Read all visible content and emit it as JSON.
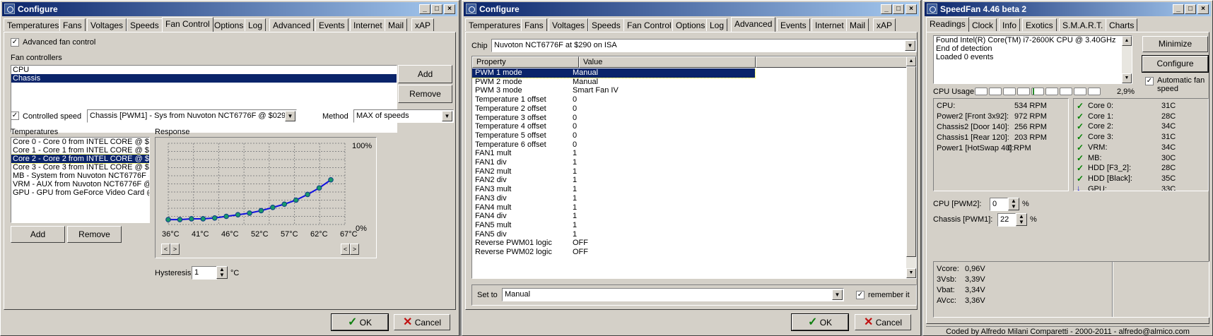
{
  "configure1": {
    "title": "Configure",
    "tabs": [
      "Temperatures",
      "Fans",
      "Voltages",
      "Speeds",
      "Fan Control",
      "Options",
      "Log",
      "Advanced",
      "Events",
      "Internet",
      "Mail",
      "xAP"
    ],
    "advanced_fan_control_label": "Advanced fan control",
    "fan_controllers_label": "Fan controllers",
    "fan_controllers": [
      "CPU",
      "Chassis"
    ],
    "add_label": "Add",
    "remove_label": "Remove",
    "controlled_speed_label": "Controlled speed",
    "controlled_speed_value": "Chassis [PWM1] - Sys from Nuvoton NCT6776F @ $0290",
    "method_label": "Method",
    "method_value": "MAX of speeds",
    "temperatures_label": "Temperatures",
    "temperatures": [
      "Core 0 - Core 0 from INTEL CORE @ $0",
      "Core 1 - Core 1 from INTEL CORE @ $0",
      "Core 2 - Core 2 from INTEL CORE @ $0",
      "Core 3 - Core 3 from INTEL CORE @ $0",
      "MB - System from Nuvoton NCT6776F @",
      "VRM - AUX from Nuvoton NCT6776F @",
      "GPU - GPU from GeForce Video Card @"
    ],
    "response_label": "Response",
    "response_top_label": "100%",
    "response_bottom_label": "0%",
    "response_x_labels": [
      "36°C",
      "41°C",
      "46°C",
      "52°C",
      "57°C",
      "62°C",
      "67°C"
    ],
    "response_curve": [
      6,
      6,
      7,
      7,
      8,
      10,
      12,
      14,
      17,
      21,
      25,
      30,
      37,
      45,
      55
    ],
    "hysteresis_label": "Hysteresis",
    "hysteresis_value": "1",
    "hysteresis_unit": "°C",
    "ok_label": "OK",
    "cancel_label": "Cancel"
  },
  "configure2": {
    "title": "Configure",
    "tabs": [
      "Temperatures",
      "Fans",
      "Voltages",
      "Speeds",
      "Fan Control",
      "Options",
      "Log",
      "Advanced",
      "Events",
      "Internet",
      "Mail",
      "xAP"
    ],
    "chip_label": "Chip",
    "chip_value": "Nuvoton NCT6776F at $290 on ISA",
    "col_property": "Property",
    "col_value": "Value",
    "rows": [
      [
        "PWM 1 mode",
        "Manual"
      ],
      [
        "PWM 2 mode",
        "Manual"
      ],
      [
        "PWM 3 mode",
        "Smart Fan IV"
      ],
      [
        "Temperature 1 offset",
        "0"
      ],
      [
        "Temperature 2 offset",
        "0"
      ],
      [
        "Temperature 3 offset",
        "0"
      ],
      [
        "Temperature 4 offset",
        "0"
      ],
      [
        "Temperature 5 offset",
        "0"
      ],
      [
        "Temperature 6 offset",
        "0"
      ],
      [
        "FAN1 mult",
        "1"
      ],
      [
        "FAN1 div",
        "1"
      ],
      [
        "FAN2 mult",
        "1"
      ],
      [
        "FAN2 div",
        "1"
      ],
      [
        "FAN3 mult",
        "1"
      ],
      [
        "FAN3 div",
        "1"
      ],
      [
        "FAN4 mult",
        "1"
      ],
      [
        "FAN4 div",
        "1"
      ],
      [
        "FAN5 mult",
        "1"
      ],
      [
        "FAN5 div",
        "1"
      ],
      [
        "Reverse PWM01 logic",
        "OFF"
      ],
      [
        "Reverse PWM02 logic",
        "OFF"
      ]
    ],
    "set_to_label": "Set to",
    "set_to_value": "Manual",
    "remember_label": "remember it",
    "ok_label": "OK",
    "cancel_label": "Cancel"
  },
  "speedfan": {
    "title": "SpeedFan 4.46 beta 2",
    "tabs": [
      "Readings",
      "Clock",
      "Info",
      "Exotics",
      "S.M.A.R.T.",
      "Charts"
    ],
    "log_lines": [
      "Found Intel(R) Core(TM) i7-2600K CPU @ 3.40GHz",
      "End of detection",
      "Loaded 0 events"
    ],
    "minimize_label": "Minimize",
    "configure_label": "Configure",
    "auto_fan_label": "Automatic fan speed",
    "cpu_usage_label": "CPU Usage",
    "cpu_usage_value": "2,9%",
    "cpu_usage_fraction": 0.029,
    "fans": [
      [
        "CPU:",
        "534 RPM"
      ],
      [
        "Power2 [Front 3x92]:",
        "972 RPM"
      ],
      [
        "Chassis2 [Door 140]:",
        "256 RPM"
      ],
      [
        "Chassis1 [Rear 120]:",
        "203 RPM"
      ],
      [
        "Power1 [HotSwap 40]:",
        "0 RPM"
      ]
    ],
    "temps": [
      [
        "Core 0:",
        "31C",
        "ok"
      ],
      [
        "Core 1:",
        "28C",
        "ok"
      ],
      [
        "Core 2:",
        "34C",
        "ok"
      ],
      [
        "Core 3:",
        "31C",
        "ok"
      ],
      [
        "VRM:",
        "34C",
        "ok"
      ],
      [
        "MB:",
        "30C",
        "ok"
      ],
      [
        "HDD [F3_2]:",
        "28C",
        "ok"
      ],
      [
        "HDD [Black]:",
        "35C",
        "ok"
      ],
      [
        "GPU:",
        "33C",
        "down"
      ]
    ],
    "pwm": [
      [
        "CPU [PWM2]:",
        "0",
        "%"
      ],
      [
        "Chassis [PWM1]:",
        "22",
        "%"
      ]
    ],
    "voltages": [
      [
        "Vcore:",
        "0,96V"
      ],
      [
        "3Vsb:",
        "3,39V"
      ],
      [
        "Vbat:",
        "3,34V"
      ],
      [
        "AVcc:",
        "3,36V"
      ]
    ],
    "footer": "Coded by Alfredo Milani Comparetti - 2000-2011 - alfredo@almico.com"
  }
}
